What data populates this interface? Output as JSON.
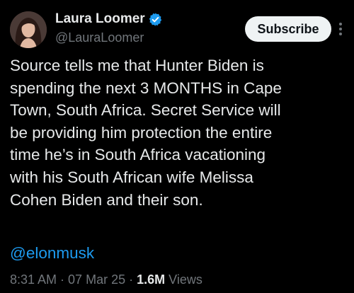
{
  "author": {
    "display_name": "Laura Loomer",
    "handle": "@LauraLoomer",
    "verified": true
  },
  "actions": {
    "subscribe_label": "Subscribe",
    "more_icon": "more-vertical-icon"
  },
  "tweet": {
    "lines": [
      "Source tells me that Hunter Biden is",
      "spending the next 3 MONTHS in Cape",
      "Town, South Africa. Secret Service will",
      "be providing him protection the entire",
      "time he’s in South Africa vacationing",
      "with his South African wife Melissa",
      "Cohen Biden and their son."
    ],
    "mention": "@elonmusk"
  },
  "meta": {
    "time": "8:31 AM",
    "date": "07 Mar 25",
    "views_count": "1.6M",
    "views_label": "Views",
    "separator": "·"
  },
  "colors": {
    "background": "#000000",
    "text": "#e7e9ea",
    "secondary": "#71767b",
    "link": "#1d9bf0",
    "verified_badge": "#1d9bf0",
    "button_bg": "#eff3f4"
  }
}
